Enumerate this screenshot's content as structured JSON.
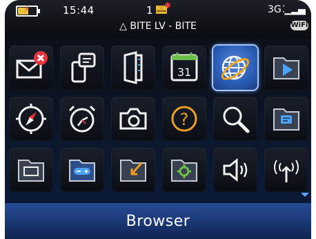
{
  "status_bar": {
    "time": "15:44",
    "unread_count": "1",
    "carrier": "△ BITE LV - BITE",
    "network_type": "3G",
    "wifi_badge": "WiFi"
  },
  "home_screen": {
    "selected_app_label": "Browser",
    "icons": [
      {
        "row": 1,
        "col": 1,
        "name": "messages-icon",
        "selected": false
      },
      {
        "row": 1,
        "col": 2,
        "name": "messenger-icon",
        "selected": false
      },
      {
        "row": 1,
        "col": 3,
        "name": "contacts-icon",
        "selected": false
      },
      {
        "row": 1,
        "col": 4,
        "name": "calendar-icon",
        "selected": false,
        "text": "31"
      },
      {
        "row": 1,
        "col": 5,
        "name": "browser-globe-icon",
        "selected": true
      },
      {
        "row": 1,
        "col": 6,
        "name": "media-folder-icon",
        "selected": false
      },
      {
        "row": 2,
        "col": 1,
        "name": "maps-compass-icon",
        "selected": false
      },
      {
        "row": 2,
        "col": 2,
        "name": "clock-alarm-icon",
        "selected": false
      },
      {
        "row": 2,
        "col": 3,
        "name": "camera-icon",
        "selected": false
      },
      {
        "row": 2,
        "col": 4,
        "name": "help-icon",
        "selected": false
      },
      {
        "row": 2,
        "col": 5,
        "name": "search-icon",
        "selected": false
      },
      {
        "row": 2,
        "col": 6,
        "name": "instant-messaging-folder-icon",
        "selected": false
      },
      {
        "row": 3,
        "col": 1,
        "name": "applications-folder-icon",
        "selected": false
      },
      {
        "row": 3,
        "col": 2,
        "name": "games-folder-icon",
        "selected": false
      },
      {
        "row": 3,
        "col": 3,
        "name": "downloads-folder-icon",
        "selected": false
      },
      {
        "row": 3,
        "col": 4,
        "name": "settings-folder-icon",
        "selected": false
      },
      {
        "row": 3,
        "col": 5,
        "name": "sounds-icon",
        "selected": false
      },
      {
        "row": 3,
        "col": 6,
        "name": "manage-connections-icon",
        "selected": false
      }
    ]
  },
  "colors": {
    "accent": "#2c5fb9",
    "label_bar": "#1c3b7b",
    "calendar_green": "#6cc04a",
    "help_orange": "#f0a020",
    "new_badge_red": "#e8323c"
  }
}
